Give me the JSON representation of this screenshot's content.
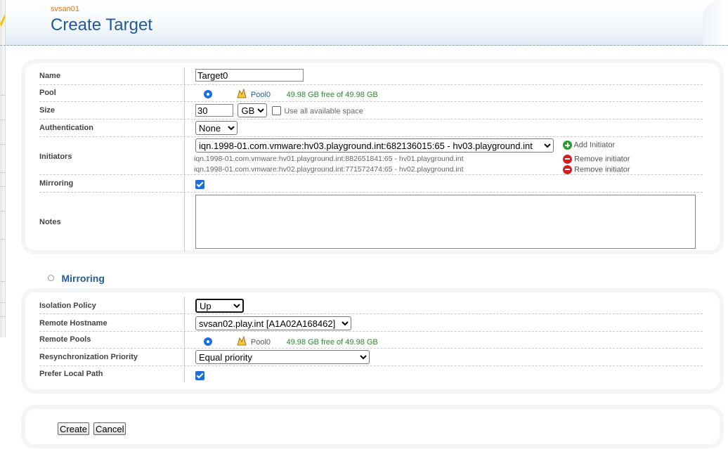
{
  "header": {
    "server_name": "svsan01",
    "title": "Create Target"
  },
  "form": {
    "name_label": "Name",
    "name_value": "Target0",
    "pool_label": "Pool",
    "pool_name": "Pool0",
    "pool_free": "49.98 GB free of 49.98 GB",
    "size_label": "Size",
    "size_value": "30",
    "size_unit": "GB",
    "use_all_label": "Use all available space",
    "auth_label": "Authentication",
    "auth_value": "None",
    "initiators_label": "Initiators",
    "initiator_selected": "iqn.1998-01.com.vmware:hv03.playground.int:682136015:65 - hv03.playground.int",
    "add_initiator": "Add Initiator",
    "initiators": [
      {
        "text": "iqn.1998-01.com.vmware:hv01.playground.int:882651841:65 - hv01.playground.int",
        "action": "Remove initiator"
      },
      {
        "text": "iqn.1998-01.com.vmware:hv02.playground.int:771572474:65 - hv02.playground.int",
        "action": "Remove initiator"
      }
    ],
    "mirroring_label": "Mirroring",
    "notes_label": "Notes",
    "notes_value": ""
  },
  "mirroring": {
    "section_title": "Mirroring",
    "isolation_label": "Isolation Policy",
    "isolation_value": "Up",
    "remote_host_label": "Remote Hostname",
    "remote_host_value": "svsan02.play.int [A1A02A168462]",
    "remote_pools_label": "Remote Pools",
    "remote_pool_name": "Pool0",
    "remote_pool_free": "49.98 GB free of 49.98 GB",
    "resync_label": "Resynchronization Priority",
    "resync_value": "Equal priority",
    "prefer_local_label": "Prefer Local Path"
  },
  "actions": {
    "create": "Create",
    "cancel": "Cancel"
  },
  "colors": {
    "title_blue": "#1f5a9b",
    "server_orange": "#e07b10",
    "free_green": "#2a8a2a",
    "accent_blue": "#1f6fd9"
  }
}
